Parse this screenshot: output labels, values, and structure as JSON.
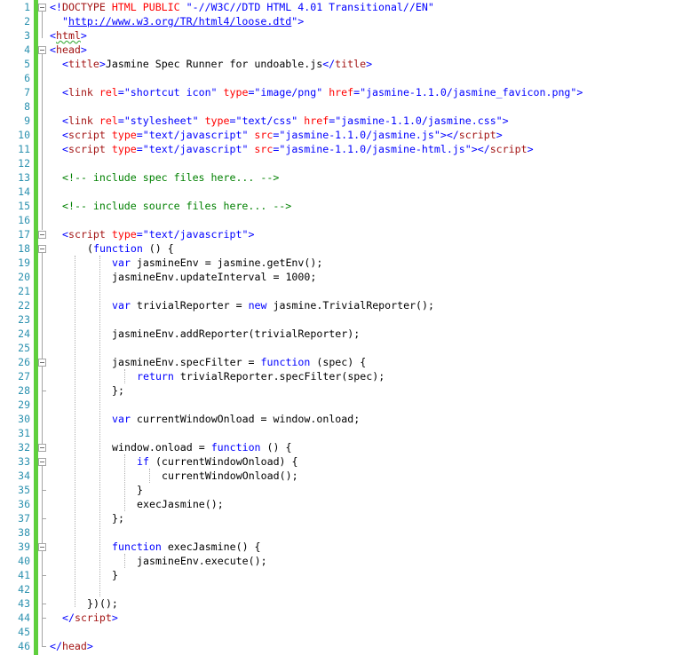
{
  "editor": {
    "line_numbers": [
      "1",
      "2",
      "3",
      "4",
      "5",
      "6",
      "7",
      "8",
      "9",
      "10",
      "11",
      "12",
      "13",
      "14",
      "15",
      "16",
      "17",
      "18",
      "19",
      "20",
      "21",
      "22",
      "23",
      "24",
      "25",
      "26",
      "27",
      "28",
      "29",
      "30",
      "31",
      "32",
      "33",
      "34",
      "35",
      "36",
      "37",
      "38",
      "39",
      "40",
      "41",
      "42",
      "43",
      "44",
      "45",
      "46"
    ],
    "colors": {
      "line_number": "#2b91af",
      "change_bar": "#5fcf3d",
      "keyword": "#0000ff",
      "tag": "#a31515",
      "attribute": "#ff0000",
      "string": "#0000ff",
      "comment": "#008000",
      "text": "#000000"
    },
    "code": {
      "l1": [
        "<!",
        "DOCTYPE",
        " ",
        "HTML",
        " ",
        "PUBLIC",
        " ",
        "\"-//W3C//DTD HTML 4.01 Transitional//EN\""
      ],
      "l2": [
        "\"",
        "http://www.w3.org/TR/html4/loose.dtd",
        "\">"
      ],
      "l3": [
        "<",
        "html",
        ">"
      ],
      "l4": [
        "<",
        "head",
        ">"
      ],
      "l5": [
        "<",
        "title",
        ">",
        "Jasmine Spec Runner for undoable.js",
        "</",
        "title",
        ">"
      ],
      "l7": [
        "<",
        "link",
        " ",
        "rel",
        "=",
        "\"shortcut icon\"",
        " ",
        "type",
        "=",
        "\"image/png\"",
        " ",
        "href",
        "=",
        "\"jasmine-1.1.0/jasmine_favicon.png\"",
        ">"
      ],
      "l9": [
        "<",
        "link",
        " ",
        "rel",
        "=",
        "\"stylesheet\"",
        " ",
        "type",
        "=",
        "\"text/css\"",
        " ",
        "href",
        "=",
        "\"jasmine-1.1.0/jasmine.css\"",
        ">"
      ],
      "l10": [
        "<",
        "script",
        " ",
        "type",
        "=",
        "\"text/javascript\"",
        " ",
        "src",
        "=",
        "\"jasmine-1.1.0/jasmine.js\"",
        "></",
        "script",
        ">"
      ],
      "l11": [
        "<",
        "script",
        " ",
        "type",
        "=",
        "\"text/javascript\"",
        " ",
        "src",
        "=",
        "\"jasmine-1.1.0/jasmine-html.js\"",
        "></",
        "script",
        ">"
      ],
      "l13": [
        "<!-- include spec files here... -->"
      ],
      "l15": [
        "<!-- include source files here... -->"
      ],
      "l17": [
        "<",
        "script",
        " ",
        "type",
        "=",
        "\"text/javascript\"",
        ">"
      ],
      "l18": [
        "(",
        "function",
        " () {"
      ],
      "l19": [
        "var",
        " jasmineEnv = jasmine.getEnv();"
      ],
      "l20": [
        "jasmineEnv.updateInterval = 1000;"
      ],
      "l22": [
        "var",
        " trivialReporter = ",
        "new",
        " jasmine.TrivialReporter();"
      ],
      "l24": [
        "jasmineEnv.addReporter(trivialReporter);"
      ],
      "l26": [
        "jasmineEnv.specFilter = ",
        "function",
        " (spec) {"
      ],
      "l27": [
        "return",
        " trivialReporter.specFilter(spec);"
      ],
      "l28": [
        "};"
      ],
      "l30": [
        "var",
        " currentWindowOnload = window.onload;"
      ],
      "l32": [
        "window.onload = ",
        "function",
        " () {"
      ],
      "l33": [
        "if",
        " (currentWindowOnload) {"
      ],
      "l34": [
        "currentWindowOnload();"
      ],
      "l35": [
        "}"
      ],
      "l36": [
        "execJasmine();"
      ],
      "l37": [
        "};"
      ],
      "l39": [
        "function",
        " execJasmine() {"
      ],
      "l40": [
        "jasmineEnv.execute();"
      ],
      "l41": [
        "}"
      ],
      "l43": [
        "})();"
      ],
      "l44": [
        "</",
        "script",
        ">"
      ],
      "l46": [
        "</",
        "head",
        ">"
      ]
    }
  }
}
